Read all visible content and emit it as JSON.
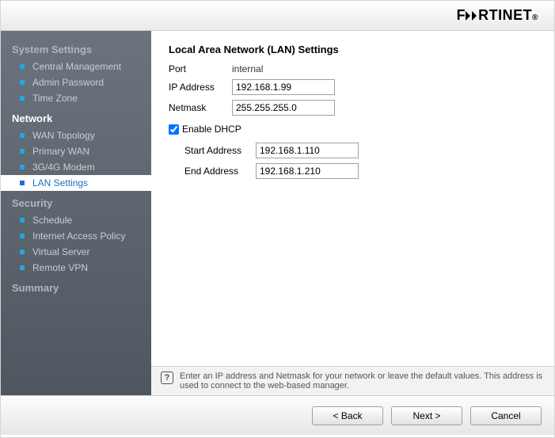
{
  "header": {
    "logo_text": "F RTINET"
  },
  "sidebar": {
    "groups": [
      {
        "title": "System Settings",
        "active": false,
        "items": [
          {
            "label": "Central Management",
            "selected": false
          },
          {
            "label": "Admin Password",
            "selected": false
          },
          {
            "label": "Time Zone",
            "selected": false
          }
        ]
      },
      {
        "title": "Network",
        "active": true,
        "items": [
          {
            "label": "WAN Topology",
            "selected": false
          },
          {
            "label": "Primary WAN",
            "selected": false
          },
          {
            "label": "3G/4G Modem",
            "selected": false
          },
          {
            "label": "LAN Settings",
            "selected": true
          }
        ]
      },
      {
        "title": "Security",
        "active": false,
        "items": [
          {
            "label": "Schedule",
            "selected": false
          },
          {
            "label": "Internet Access Policy",
            "selected": false
          },
          {
            "label": "Virtual Server",
            "selected": false
          },
          {
            "label": "Remote VPN",
            "selected": false
          }
        ]
      },
      {
        "title": "Summary",
        "active": false,
        "items": []
      }
    ]
  },
  "main": {
    "title": "Local Area Network (LAN) Settings",
    "port_label": "Port",
    "port_value": "internal",
    "ip_label": "IP Address",
    "ip_value": "192.168.1.99",
    "netmask_label": "Netmask",
    "netmask_value": "255.255.255.0",
    "dhcp_label": "Enable DHCP",
    "dhcp_checked": true,
    "start_label": "Start Address",
    "start_value": "192.168.1.110",
    "end_label": "End Address",
    "end_value": "192.168.1.210",
    "hint": "Enter an IP address and Netmask for your network or leave the default values. This address is used to connect to the web-based manager."
  },
  "footer": {
    "back_label": "< Back",
    "next_label": "Next >",
    "cancel_label": "Cancel"
  }
}
